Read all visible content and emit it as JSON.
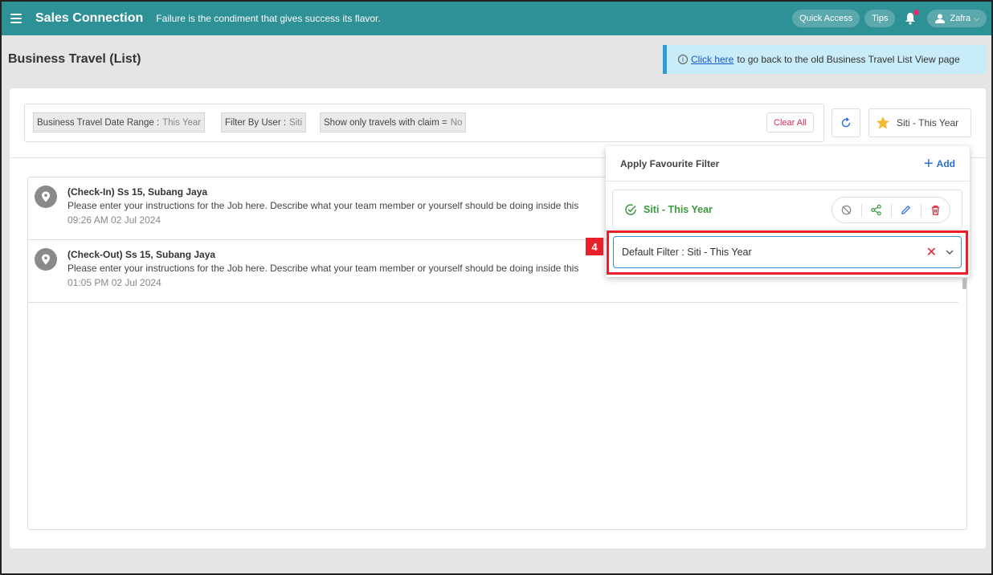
{
  "topbar": {
    "brand": "Sales Connection",
    "tagline": "Failure is the condiment that gives success its flavor.",
    "quick_access": "Quick Access",
    "tips": "Tips",
    "user": "Zafra"
  },
  "page": {
    "title": "Business Travel (List)",
    "notice_link": "Click here",
    "notice_text": "to go back to the old Business Travel List View page"
  },
  "filters": {
    "chips": [
      {
        "label": "Business Travel Date Range :",
        "value": "This Year"
      },
      {
        "label": "Filter By User :",
        "value": "Siti"
      },
      {
        "label": "Show only travels with claim =",
        "value": "No"
      }
    ],
    "clear_all": "Clear All",
    "favourite_button": "Siti - This Year"
  },
  "list": [
    {
      "title": "(Check-In) Ss 15, Subang Jaya",
      "desc": "Please enter your instructions for the Job here. Describe what your team member or yourself should be doing inside this",
      "time": "09:26 AM   02 Jul 2024"
    },
    {
      "title": "(Check-Out) Ss 15, Subang Jaya",
      "desc": "Please enter your instructions for the Job here. Describe what your team member or yourself should be doing inside this",
      "time": "01:05 PM   02 Jul 2024"
    }
  ],
  "favourite_panel": {
    "heading": "Apply Favourite Filter",
    "add": "Add",
    "item": "Siti - This Year",
    "default_filter": "Default Filter : Siti - This Year"
  },
  "annotation": {
    "step": "4"
  },
  "colors": {
    "topbar": "#2e9196",
    "accent_blue": "#2a6fd0",
    "success_green": "#3a9a3c",
    "danger_red": "#e8202a"
  },
  "icons": [
    "menu-icon",
    "bell-icon",
    "user-icon",
    "info-icon",
    "refresh-icon",
    "star-icon",
    "pin-icon",
    "check-circle-icon",
    "unset-icon",
    "share-icon",
    "edit-icon",
    "delete-icon",
    "close-icon",
    "chevron-down-icon",
    "plus-icon"
  ]
}
